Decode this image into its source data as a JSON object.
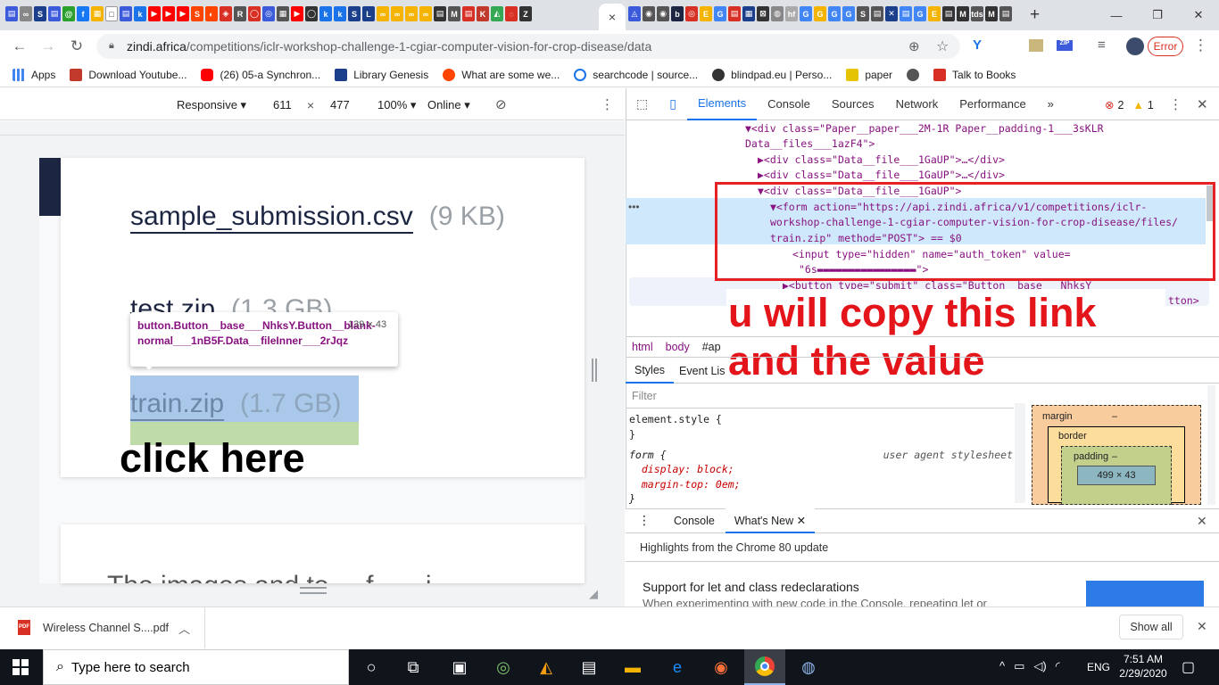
{
  "tabstrip": {
    "active_tab_close": "×",
    "new_tab": "+"
  },
  "address": {
    "domain": "zindi.africa",
    "path": "/competitions/iclr-workshop-challenge-1-cgiar-computer-vision-for-crop-disease/data",
    "error_label": "Error"
  },
  "bookmarks": [
    {
      "label": "Apps",
      "icon": "apps-grid-icon",
      "color": "#4285f4"
    },
    {
      "label": "Download Youtube...",
      "icon": "youtube-dl-icon",
      "color": "#c0392b"
    },
    {
      "label": "(26) 05-a Synchron...",
      "icon": "youtube-icon",
      "color": "#ff0000"
    },
    {
      "label": "Library Genesis",
      "icon": "library-icon",
      "color": "#1c3f8c"
    },
    {
      "label": "What are some we...",
      "icon": "reddit-icon",
      "color": "#ff4500"
    },
    {
      "label": "searchcode | source...",
      "icon": "searchcode-icon",
      "color": "#1a73e8"
    },
    {
      "label": "blindpad.eu | Perso...",
      "icon": "github-icon",
      "color": "#333333"
    },
    {
      "label": "paper",
      "icon": "paper-icon",
      "color": "#e6c300"
    },
    {
      "label": "",
      "icon": "globe-icon",
      "color": "#555555"
    },
    {
      "label": "Talk to Books",
      "icon": "books-icon",
      "color": "#d93025"
    }
  ],
  "device_toolbar": {
    "mode": "Responsive",
    "width": "611",
    "times": "×",
    "height": "477",
    "zoom": "100%",
    "network": "Online"
  },
  "page": {
    "files": [
      {
        "name": "sample_submission.csv",
        "size": "(9 KB)"
      },
      {
        "name": "test.zip",
        "size": "(1.3 GB)"
      },
      {
        "name": "train.zip",
        "size": "(1.7 GB)"
      }
    ],
    "tooltip_selector": "button.Button__base___NhksY.Button__blank-normal___1nB5F.Data__fileInner___2rJqz",
    "tooltip_size": "139 × 43",
    "partial_text": "The images and to ... f... ...i"
  },
  "annotations": {
    "click_here": "click here",
    "copy_note": "u will copy this link and the value"
  },
  "devtools": {
    "tabs": [
      "Elements",
      "Console",
      "Sources",
      "Network",
      "Performance"
    ],
    "error_count": "2",
    "warning_count": "1",
    "dom_lines": [
      "▼<div class=\"Paper__paper___2M-1R Paper__padding-1___3sKLR",
      "Data__files___1azF4\">",
      "▶<div class=\"Data__file___1GaUP\">…</div>",
      "▶<div class=\"Data__file___1GaUP\">…</div>",
      "▼<div class=\"Data__file___1GaUP\">",
      "▼<form action=\"https://api.zindi.africa/v1/competitions/iclr-",
      "workshop-challenge-1-cgiar-computer-vision-for-crop-disease/files/",
      "train.zip\" method=\"POST\"> == $0",
      "<input type=\"hidden\" name=\"auth_token\" value=",
      "\"6s▬▬▬▬▬▬▬▬▬▬▬▬▬▬▬▬\">",
      "▶<button type=\"submit\" class=\"Button__base___NhksY",
      "tton>"
    ],
    "breadcrumb": [
      "html",
      "body",
      "#ap"
    ],
    "style_tabs": [
      "Styles",
      "Event Lis"
    ],
    "filter_placeholder": "Filter",
    "styles": [
      {
        "selector": "element.style {",
        "source": ""
      },
      {
        "selector": "}",
        "source": ""
      },
      {
        "selector": "form {",
        "source": "user agent stylesheet"
      },
      {
        "selector": "  display: block;",
        "source": ""
      },
      {
        "selector": "  margin-top: 0em;",
        "source": ""
      },
      {
        "selector": "}",
        "source": ""
      }
    ],
    "box_model": {
      "margin": "margin",
      "border": "border",
      "padding": "padding",
      "content": "499 × 43",
      "dash": "–"
    },
    "drawer_tabs": [
      "Console",
      "What's New"
    ],
    "whats_new_header": "Highlights from the Chrome 80 update",
    "whats_new_title": "Support for let and class redeclarations",
    "whats_new_body": "When experimenting with new code in the Console, repeating let or"
  },
  "download": {
    "file": "Wireless Channel S....pdf",
    "show_all": "Show all"
  },
  "taskbar": {
    "search_placeholder": "Type here to search",
    "lang": "ENG",
    "time": "7:51 AM",
    "date": "2/29/2020"
  }
}
